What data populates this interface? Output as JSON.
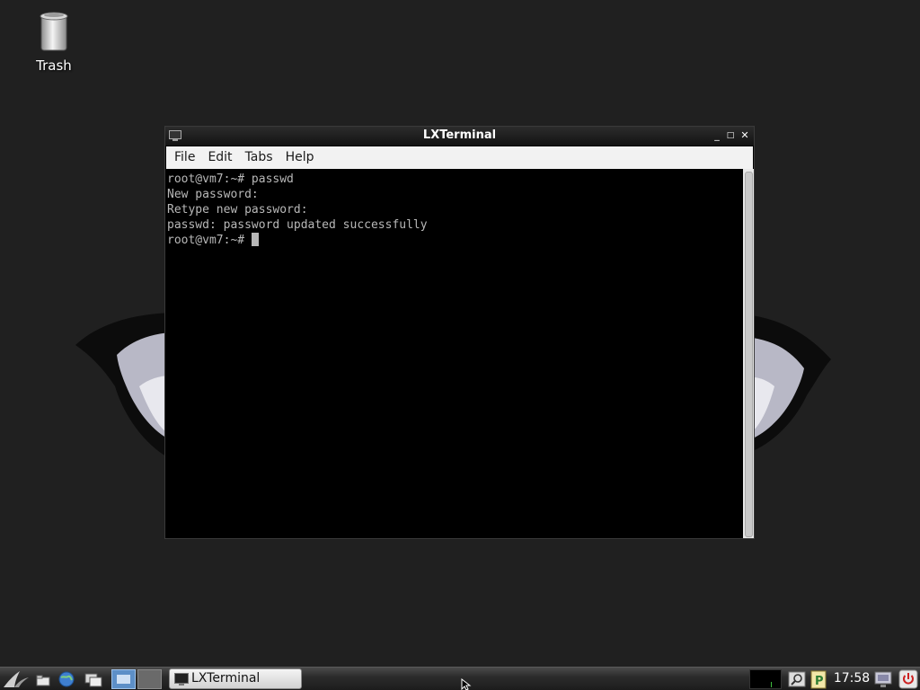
{
  "desktop": {
    "icons": [
      {
        "label": "Trash",
        "icon": "trash-icon"
      }
    ]
  },
  "window": {
    "title": "LXTerminal",
    "controls": {
      "minimize": "_",
      "maximize": "□",
      "close": "✕"
    },
    "menu": [
      "File",
      "Edit",
      "Tabs",
      "Help"
    ]
  },
  "terminal": {
    "lines": [
      "root@vm7:~# passwd",
      "New password:",
      "Retype new password:",
      "passwd: password updated successfully",
      "root@vm7:~# "
    ],
    "text_color": "#b8b8b8",
    "background_color": "#000000"
  },
  "taskbar": {
    "launchers": [
      "menu-logo-icon",
      "file-manager-icon",
      "web-browser-icon",
      "show-desktop-icon",
      "workspace-1-icon",
      "workspace-2-icon"
    ],
    "tasks": [
      {
        "label": "LXTerminal",
        "icon": "terminal-icon",
        "active": true
      }
    ],
    "tray": [
      "cpu-monitor-icon",
      "search-icon",
      "clipboard-icon"
    ],
    "clock": "17:58",
    "end_icons": [
      "monitor-icon",
      "power-icon"
    ],
    "power_color": "#cc2222"
  }
}
